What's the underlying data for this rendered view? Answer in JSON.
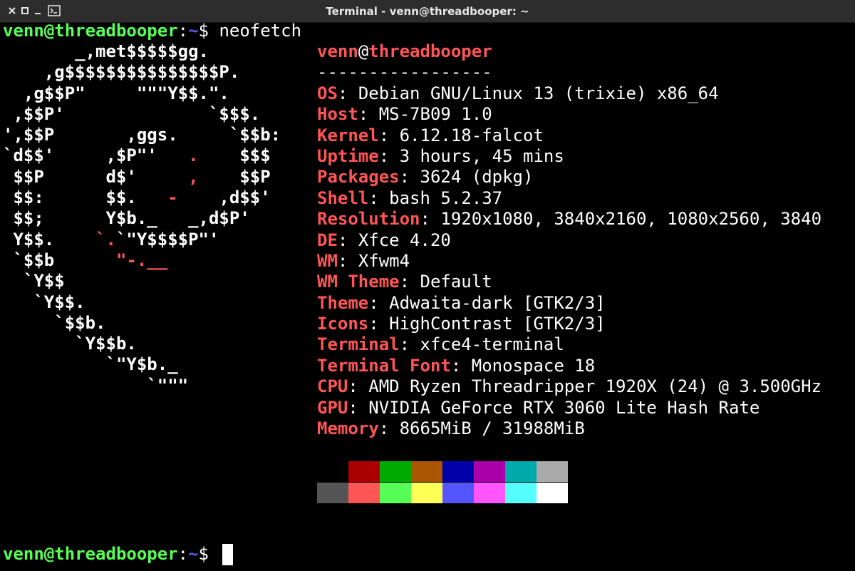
{
  "window": {
    "title": "Terminal - venn@threadbooper: ~"
  },
  "prompt1": {
    "user": "venn@threadbooper",
    "sep": ":",
    "path": "~",
    "dollar": "$",
    "command": " neofetch"
  },
  "logo": {
    "lines": [
      [
        "       _,met$$$$$gg.",
        ""
      ],
      [
        "    ,g$$$$$$$$$$$$$$$P.",
        ""
      ],
      [
        "  ,g$$P\"     \"\"\"Y$$.\".",
        ""
      ],
      [
        " ,$$P'              `$$$.",
        ""
      ],
      [
        "',$$P       ,ggs.     `$$b:",
        ""
      ],
      [
        "`d$$'     ,$P\"'   ",
        ".",
        "    $$$"
      ],
      [
        " $$P      d$'     ",
        ",",
        "    $$P"
      ],
      [
        " $$:      $$.   ",
        "-",
        "    ,d$$'"
      ],
      [
        " $$;      Y$b._   _,d$P'",
        ""
      ],
      [
        " Y$$.    ",
        "`.",
        "`\"Y$$$$P\"'"
      ],
      [
        " `$$b      ",
        "\"-.__",
        ""
      ],
      [
        "  `Y$$",
        ""
      ],
      [
        "   `Y$$.",
        ""
      ],
      [
        "     `$$b.",
        ""
      ],
      [
        "       `Y$$b.",
        ""
      ],
      [
        "          `\"Y$b._",
        ""
      ],
      [
        "              `\"\"\"",
        ""
      ]
    ]
  },
  "info": {
    "header": {
      "user": "venn",
      "at": "@",
      "host": "threadbooper"
    },
    "separator": "-----------------",
    "rows": [
      {
        "key": "OS",
        "value": "Debian GNU/Linux 13 (trixie) x86_64"
      },
      {
        "key": "Host",
        "value": "MS-7B09 1.0"
      },
      {
        "key": "Kernel",
        "value": "6.12.18-falcot"
      },
      {
        "key": "Uptime",
        "value": "3 hours, 45 mins"
      },
      {
        "key": "Packages",
        "value": "3624 (dpkg)"
      },
      {
        "key": "Shell",
        "value": "bash 5.2.37"
      },
      {
        "key": "Resolution",
        "value": "1920x1080, 3840x2160, 1080x2560, 3840"
      },
      {
        "key": "DE",
        "value": "Xfce 4.20"
      },
      {
        "key": "WM",
        "value": "Xfwm4"
      },
      {
        "key": "WM Theme",
        "value": "Default"
      },
      {
        "key": "Theme",
        "value": "Adwaita-dark [GTK2/3]"
      },
      {
        "key": "Icons",
        "value": "HighContrast [GTK2/3]"
      },
      {
        "key": "Terminal",
        "value": "xfce4-terminal"
      },
      {
        "key": "Terminal Font",
        "value": "Monospace 18"
      },
      {
        "key": "CPU",
        "value": "AMD Ryzen Threadripper 1920X (24) @ 3.500GHz"
      },
      {
        "key": "GPU",
        "value": "NVIDIA GeForce RTX 3060 Lite Hash Rate"
      },
      {
        "key": "Memory",
        "value": "8665MiB / 31988MiB"
      }
    ]
  },
  "palette": {
    "normal": [
      "#000000",
      "#aa0000",
      "#00aa00",
      "#aa5500",
      "#0000aa",
      "#aa00aa",
      "#00aaaa",
      "#aaaaaa"
    ],
    "bright": [
      "#555555",
      "#ff5555",
      "#55ff55",
      "#ffff55",
      "#5555ff",
      "#ff55ff",
      "#55ffff",
      "#ffffff"
    ]
  },
  "prompt2": {
    "user": "venn@threadbooper",
    "sep": ":",
    "path": "~",
    "dollar": "$"
  }
}
